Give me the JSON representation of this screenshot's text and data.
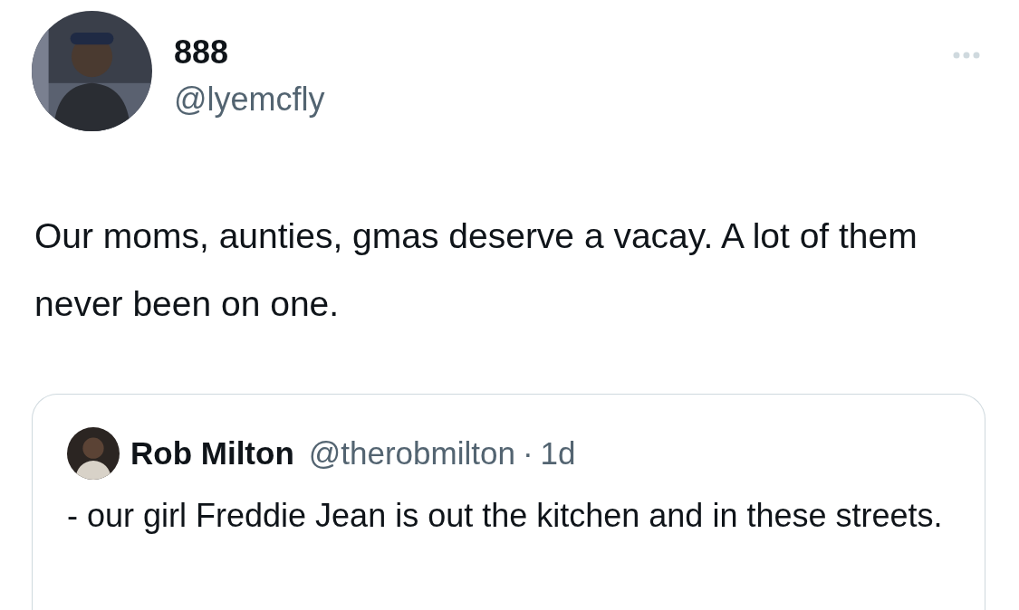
{
  "tweet": {
    "name": "888",
    "handle": "@lyemcfly",
    "text": "Our moms, aunties, gmas deserve a vacay. A lot of them never been on one.",
    "quote": {
      "name": "Rob Milton",
      "handle": "@therobmilton",
      "separator": "·",
      "time": "1d",
      "text": "- our girl Freddie Jean is out the kitchen and in these streets."
    }
  }
}
